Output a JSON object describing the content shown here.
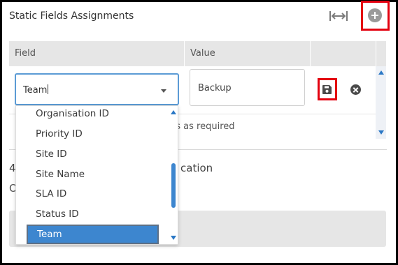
{
  "panel": {
    "title": "Static Fields Assignments"
  },
  "table": {
    "headers": [
      "Field",
      "Value"
    ],
    "row": {
      "field_value": "Team",
      "value_value": "Backup"
    },
    "hint_text": "ds as required"
  },
  "section": {
    "number_fragment": "4",
    "title_fragment": "cation",
    "subtext_fragment": "O"
  },
  "dropdown": {
    "options": [
      "Organisation ID",
      "Priority ID",
      "Site ID",
      "Site Name",
      "SLA ID",
      "Status ID",
      "Team"
    ],
    "selected": "Team"
  },
  "icons": {
    "fit_width": "fit-width-icon",
    "add": "add-circle-icon",
    "save": "save-icon",
    "delete": "delete-circle-icon",
    "dropdown_arrow": "chevron-down-icon"
  },
  "colors": {
    "highlight_border": "#e3000f",
    "accent": "#3d86cf",
    "focus_border": "#5b9bd5"
  }
}
